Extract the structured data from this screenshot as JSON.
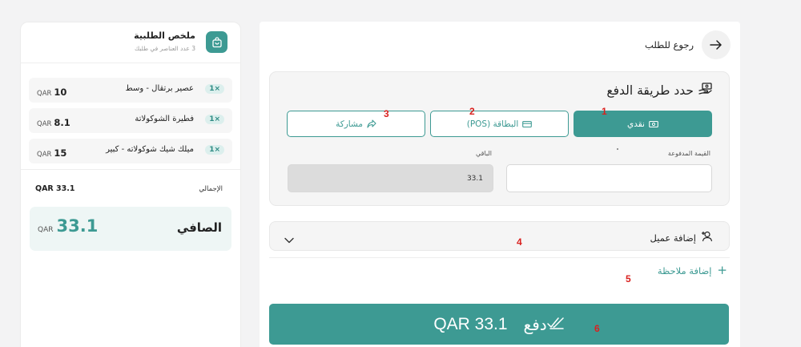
{
  "summary": {
    "title": "ملخص الطلبية",
    "subtitle": "3 عدد العناصر في طلبك",
    "items": [
      {
        "qty": "1×",
        "name": "عصير برتقال - وسط",
        "currency": "QAR",
        "price": "10"
      },
      {
        "qty": "1×",
        "name": "فطيرة الشوكولاتة",
        "currency": "QAR",
        "price": "8.1"
      },
      {
        "qty": "1×",
        "name": "ميلك شيك شوكولاته - كبير",
        "currency": "QAR",
        "price": "15"
      }
    ],
    "total_label": "الإجمالي",
    "total_value": "QAR 33.1",
    "net_label": "الصافي",
    "net_currency": "QAR",
    "net_value": "33.1"
  },
  "main": {
    "back_label": "رجوع للطلب",
    "payment_title": "حدد طريقة الدفع",
    "methods": [
      {
        "label": "نقدي",
        "icon": "cash-icon",
        "active": true,
        "badge": "1"
      },
      {
        "label": "البطاقة (POS)",
        "icon": "card-icon",
        "active": false,
        "badge": "2"
      },
      {
        "label": "مشاركة",
        "icon": "share-icon",
        "active": false,
        "badge": "3"
      }
    ],
    "paid_label": "القيمة المدفوعة",
    "paid_value": "",
    "remaining_label": "الباقي",
    "remaining_value": "33.1",
    "customer_label": "إضافة عميل",
    "customer_badge": "4",
    "note_label": "إضافة ملاحظة",
    "note_badge": "5",
    "pay_label": "دفع",
    "pay_amount": "QAR 33.1",
    "pay_badge": "6"
  },
  "colors": {
    "accent": "#3d9a93",
    "badge": "#d9211f",
    "panel": "#f5f5f5"
  }
}
